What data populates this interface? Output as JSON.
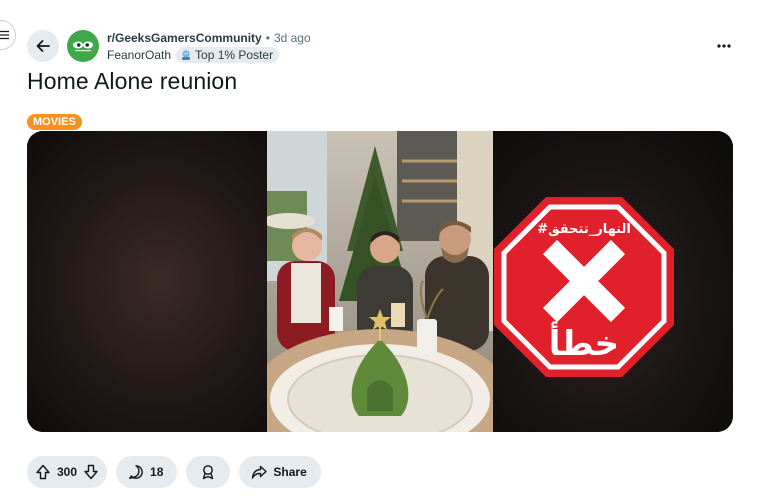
{
  "post": {
    "subreddit": "r/GeeksGamersCommunity",
    "separator": "•",
    "time_ago": "3d ago",
    "author": "FeanorOath",
    "author_flair": "Top 1% Poster",
    "title": "Home Alone reunion",
    "tag": "MOVIES",
    "overlay_top_text": "#النهار_تتحقق",
    "overlay_bottom_text": "خطأ",
    "overlay_color": "#e0202a"
  },
  "actions": {
    "upvotes": "300",
    "comments": "18",
    "share_label": "Share"
  },
  "icons": [
    "menu-icon",
    "back-arrow-icon",
    "subreddit-avatar",
    "flair-icon",
    "more-options-icon",
    "upvote-icon",
    "downvote-icon",
    "comment-icon",
    "award-icon",
    "share-icon"
  ],
  "colors": {
    "tag_bg": "#f7921e",
    "avatar_bg": "#3fa84a",
    "pill_bg": "#e5ebee"
  }
}
